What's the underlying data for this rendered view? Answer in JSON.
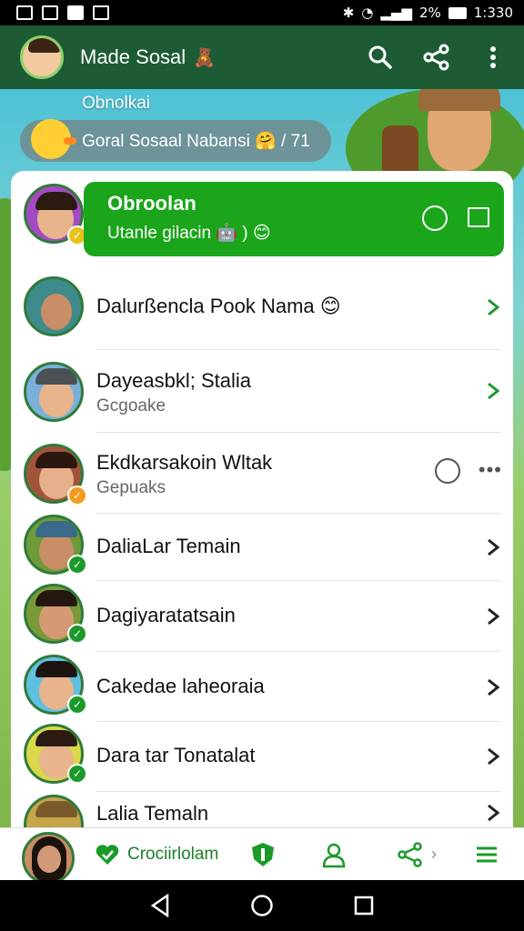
{
  "status_bar": {
    "time": "1:330",
    "battery_text": "2%"
  },
  "app_bar": {
    "title": "Made Sosal",
    "title_emoji": "🧸"
  },
  "scene": {
    "caption": "Obnolkai",
    "group": "Goral Sosaal Nabansi 🤗 / 71"
  },
  "highlight": {
    "title": "Obroolan",
    "subtitle": "Utanle gilacin 🤖 ) 😊"
  },
  "contacts": [
    {
      "name": "Dalurßencla Pook Nama 😊",
      "sub": ""
    },
    {
      "name": "Dayeasbkl; Stalia",
      "sub": "Gcgoake"
    },
    {
      "name": "Ekdkarsakoin Wltak",
      "sub": "Gepuaks"
    },
    {
      "name": "DaliaLar Temain",
      "sub": ""
    },
    {
      "name": "Dagiyaratatsain",
      "sub": ""
    },
    {
      "name": "Cakedae laheoraia",
      "sub": ""
    },
    {
      "name": "Dara tar Tonatalat",
      "sub": ""
    },
    {
      "name": "Lalia Temaln",
      "sub": ""
    }
  ],
  "bottom_nav": {
    "label": "Crociirlolam"
  },
  "colors": {
    "app_bar": "#1d5b35",
    "highlight": "#1aa51a",
    "accent_green": "#1b9a2a"
  }
}
